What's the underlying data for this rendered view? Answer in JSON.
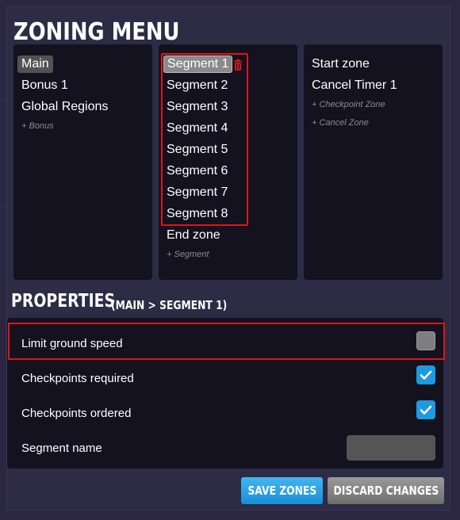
{
  "title": "ZONING MENU",
  "tracks": {
    "items": [
      {
        "label": "Main",
        "selected": true
      },
      {
        "label": "Bonus 1"
      },
      {
        "label": "Global Regions"
      }
    ],
    "add_label": "+ Bonus"
  },
  "segments": {
    "items": [
      {
        "label": "Segment 1",
        "selected": true
      },
      {
        "label": "Segment 2"
      },
      {
        "label": "Segment 3"
      },
      {
        "label": "Segment 4"
      },
      {
        "label": "Segment 5"
      },
      {
        "label": "Segment 6"
      },
      {
        "label": "Segment 7"
      },
      {
        "label": "Segment 8"
      }
    ],
    "end_zone": "End zone",
    "add_label": "+ Segment",
    "delete_icon": "trash-icon",
    "delete_color": "#e0141b"
  },
  "zones": {
    "items": [
      {
        "label": "Start zone"
      },
      {
        "label": "Cancel Timer 1"
      }
    ],
    "add_checkpoint": "+ Checkpoint Zone",
    "add_cancel": "+ Cancel Zone"
  },
  "properties": {
    "title": "PROPERTIES",
    "subtitle": "(MAIN > SEGMENT 1)",
    "rows": [
      {
        "label": "Limit ground speed",
        "checked": false
      },
      {
        "label": "Checkpoints required",
        "checked": true
      },
      {
        "label": "Checkpoints ordered",
        "checked": true
      },
      {
        "label": "Segment name",
        "value": ""
      }
    ]
  },
  "buttons": {
    "save": "SAVE ZONES",
    "discard": "DISCARD CHANGES"
  },
  "colors": {
    "accent": "#1e9ae0",
    "highlight": "#e0141b",
    "panel": "#14121f",
    "window": "#2e2b45"
  }
}
